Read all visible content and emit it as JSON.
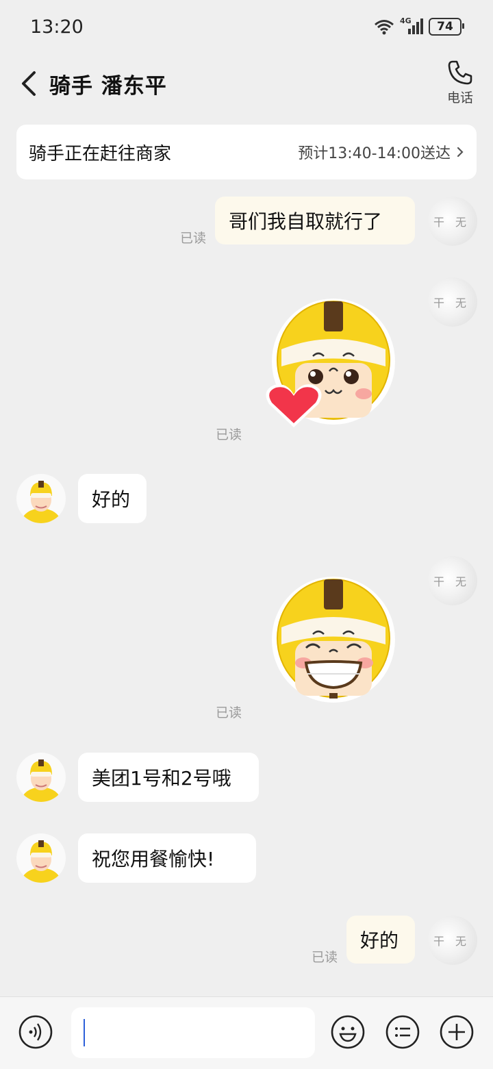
{
  "status_bar": {
    "time": "13:20",
    "network": "4G",
    "battery": "74"
  },
  "header": {
    "title": "骑手 潘东平",
    "call_label": "电话"
  },
  "banner": {
    "status": "骑手正在赶往商家",
    "eta": "预计13:40-14:00送达"
  },
  "messages": [
    {
      "from": "me",
      "type": "text",
      "text": "哥们我自取就行了",
      "read": "已读"
    },
    {
      "from": "me",
      "type": "sticker",
      "sticker": "rider-mascot-heart",
      "read": "已读"
    },
    {
      "from": "rider",
      "type": "text",
      "text": "好的"
    },
    {
      "from": "me",
      "type": "sticker",
      "sticker": "rider-mascot-grin",
      "read": "已读"
    },
    {
      "from": "rider",
      "type": "text",
      "text": "美团1号和2号哦"
    },
    {
      "from": "rider",
      "type": "text",
      "text": "祝您用餐愉快!"
    },
    {
      "from": "me",
      "type": "text",
      "text": "好的",
      "read": "已读"
    }
  ],
  "input": {
    "value": "",
    "placeholder": ""
  },
  "toolbar": {
    "voice": "voice-icon",
    "emoji": "emoji-icon",
    "phrases": "list-icon",
    "more": "plus-icon"
  },
  "colors": {
    "background": "#efefef",
    "my_bubble": "#fdf9ec",
    "other_bubble": "#ffffff",
    "mascot_yellow": "#f7d21d"
  }
}
